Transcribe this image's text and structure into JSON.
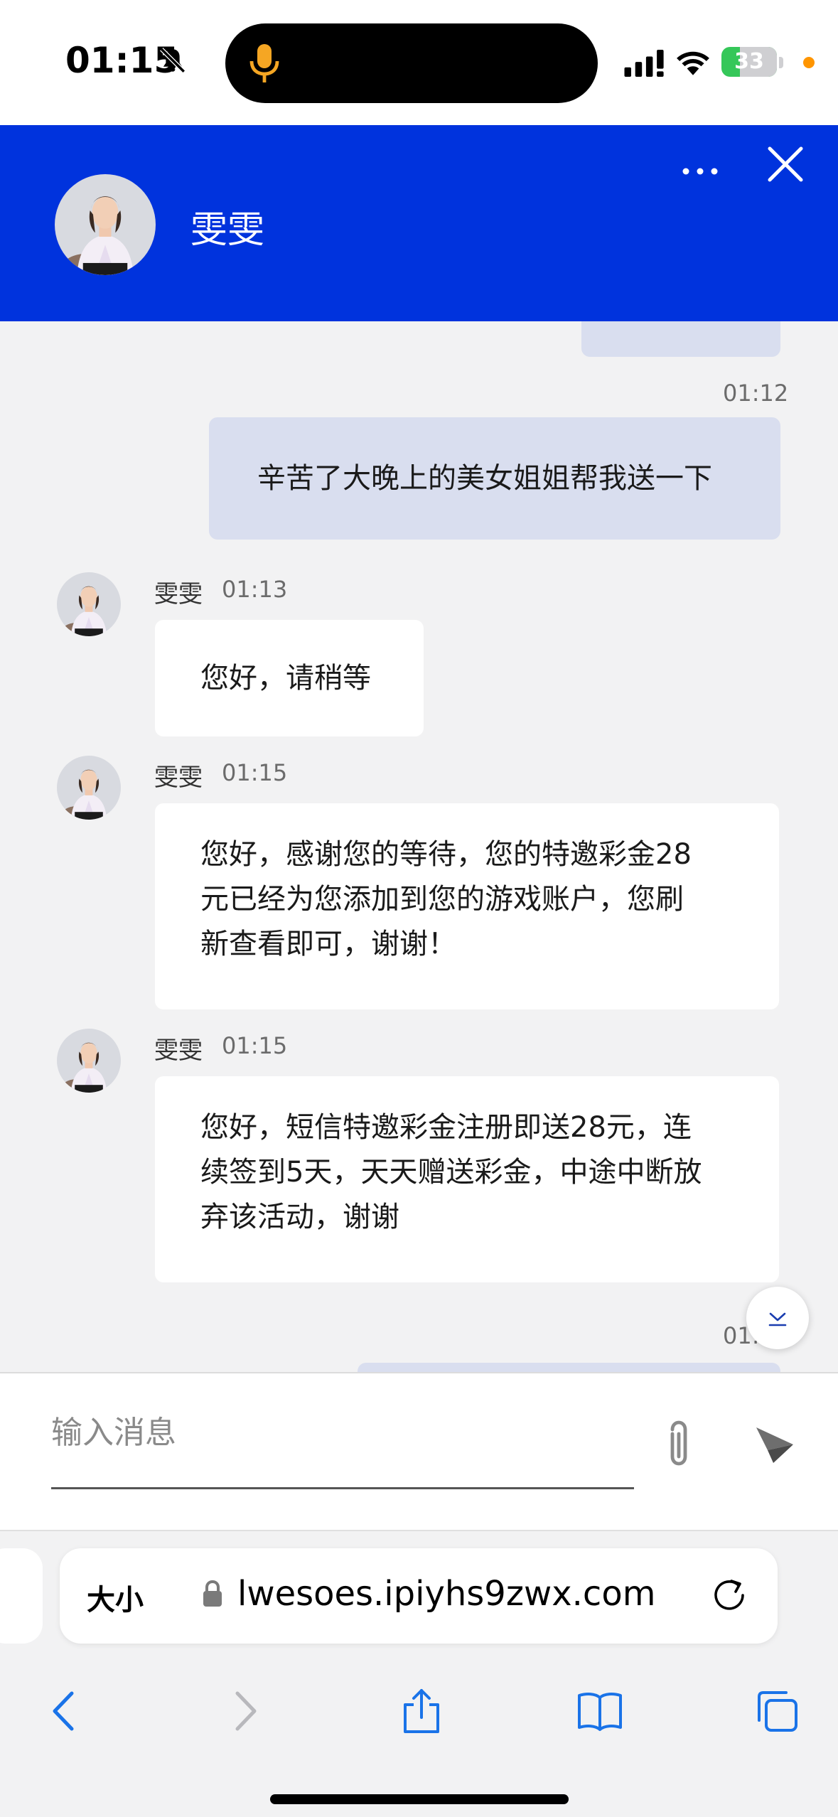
{
  "status_bar": {
    "time": "01:15",
    "battery": "33",
    "battery_level": 0.33
  },
  "header": {
    "name": "雯雯"
  },
  "messages": [
    {
      "direction": "out",
      "time": "01:12",
      "text": "辛苦了大晚上的美女姐姐帮我送一下"
    },
    {
      "direction": "in",
      "sender": "雯雯",
      "time": "01:13",
      "lines": [
        "您好，请稍等"
      ]
    },
    {
      "direction": "in",
      "sender": "雯雯",
      "time": "01:15",
      "lines": [
        "您好，感谢您的等待，您的特邀彩金28",
        "元已经为您添加到您的游戏账户，您刷",
        "新查看即可，谢谢！"
      ]
    },
    {
      "direction": "in",
      "sender": "雯雯",
      "time": "01:15",
      "lines": [
        "您好，短信特邀彩金注册即送28元，连",
        "续签到5天，天天赠送彩金，中途中断放",
        "弃该活动，谢谢"
      ]
    },
    {
      "direction": "out",
      "time_partial": "01:1"
    }
  ],
  "composer": {
    "placeholder": "输入消息"
  },
  "browser": {
    "text_size_label": "大小",
    "url": "lwesoes.ipiyhs9zwx.com"
  },
  "colors": {
    "header_bg": "#0033dd",
    "outgoing_bubble": "#d9deef",
    "incoming_bubble": "#ffffff",
    "ios_blue": "#1a73e8"
  },
  "icons": [
    "bell-slash-icon",
    "microphone-icon",
    "signal-icon",
    "wifi-icon",
    "more-icon",
    "close-icon",
    "chevron-down-icon",
    "paperclip-icon",
    "send-icon",
    "lock-icon",
    "reload-icon",
    "back-icon",
    "forward-icon",
    "share-icon",
    "bookmarks-icon",
    "tabs-icon"
  ]
}
